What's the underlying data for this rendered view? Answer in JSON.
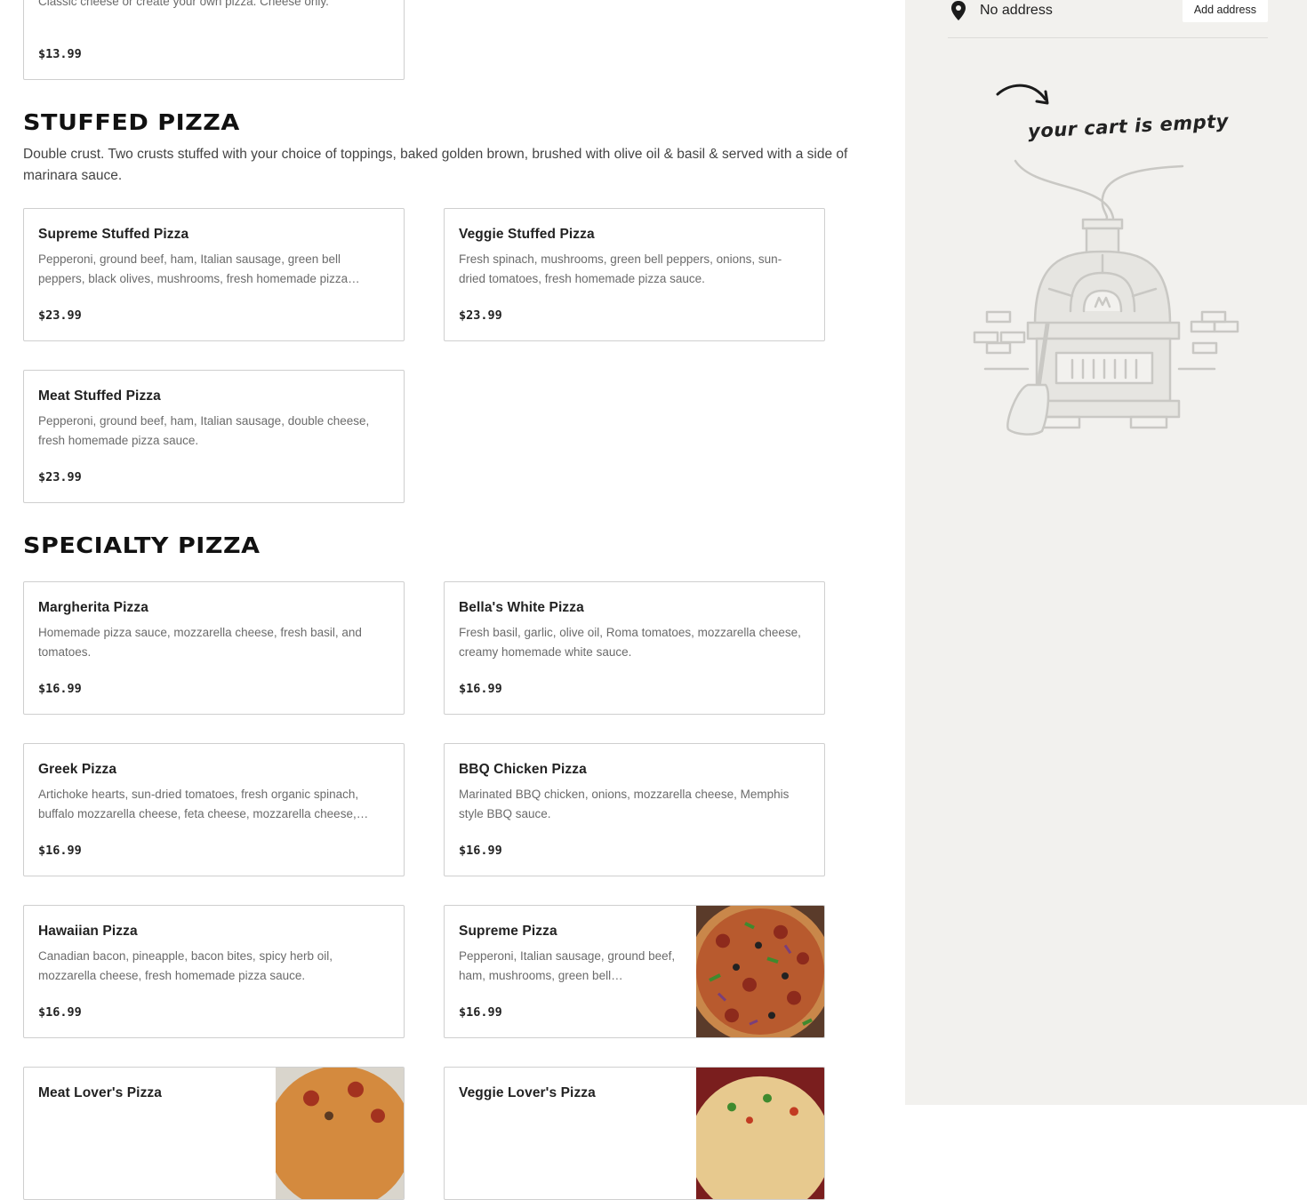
{
  "sections": [
    {
      "title": "STUFFED PIZZA",
      "description": "Double crust. Two crusts stuffed with your choice of toppings, baked golden brown, brushed with olive oil & basil & served with a side of marinara sauce."
    },
    {
      "title": "SPECIALTY PIZZA",
      "description": ""
    }
  ],
  "partial_item": {
    "description": "Classic cheese or create your own pizza. Cheese only.",
    "price": "$13.99"
  },
  "stuffed_items": [
    {
      "name": "Supreme Stuffed Pizza",
      "description": "Pepperoni, ground beef, ham, Italian sausage, green bell peppers, black olives, mushrooms, fresh homemade pizza…",
      "price": "$23.99"
    },
    {
      "name": "Veggie Stuffed Pizza",
      "description": "Fresh spinach, mushrooms, green bell peppers, onions, sun-dried tomatoes, fresh homemade pizza sauce.",
      "price": "$23.99"
    },
    {
      "name": "Meat Stuffed Pizza",
      "description": "Pepperoni, ground beef, ham, Italian sausage, double cheese, fresh homemade pizza sauce.",
      "price": "$23.99"
    }
  ],
  "specialty_items": [
    {
      "name": "Margherita Pizza",
      "description": "Homemade pizza sauce, mozzarella cheese, fresh basil, and tomatoes.",
      "price": "$16.99"
    },
    {
      "name": "Bella's White Pizza",
      "description": "Fresh basil, garlic, olive oil, Roma tomatoes, mozzarella cheese, creamy homemade white sauce.",
      "price": "$16.99"
    },
    {
      "name": "Greek Pizza",
      "description": "Artichoke hearts, sun-dried tomatoes, fresh organic spinach, buffalo mozzarella cheese, feta cheese, mozzarella cheese,…",
      "price": "$16.99"
    },
    {
      "name": "BBQ Chicken Pizza",
      "description": "Marinated BBQ chicken, onions, mozzarella cheese, Memphis style BBQ sauce.",
      "price": "$16.99"
    },
    {
      "name": "Hawaiian Pizza",
      "description": "Canadian bacon, pineapple, bacon bites, spicy herb oil, mozzarella cheese, fresh homemade pizza sauce.",
      "price": "$16.99"
    },
    {
      "name": "Supreme Pizza",
      "description": "Pepperoni, Italian sausage, ground beef, ham, mushrooms, green bell…",
      "price": "$16.99"
    },
    {
      "name": "Meat Lover's Pizza",
      "description": "",
      "price": ""
    },
    {
      "name": "Veggie Lover's Pizza",
      "description": "",
      "price": ""
    }
  ],
  "cart": {
    "address_text": "No address",
    "add_address_label": "Add address",
    "empty_message": "your cart is empty",
    "pin_icon": "map-pin-icon"
  },
  "colors": {
    "cart_bg": "#f2f1ee",
    "card_border": "#cfcfcf",
    "text_muted": "#6b6b6b"
  }
}
